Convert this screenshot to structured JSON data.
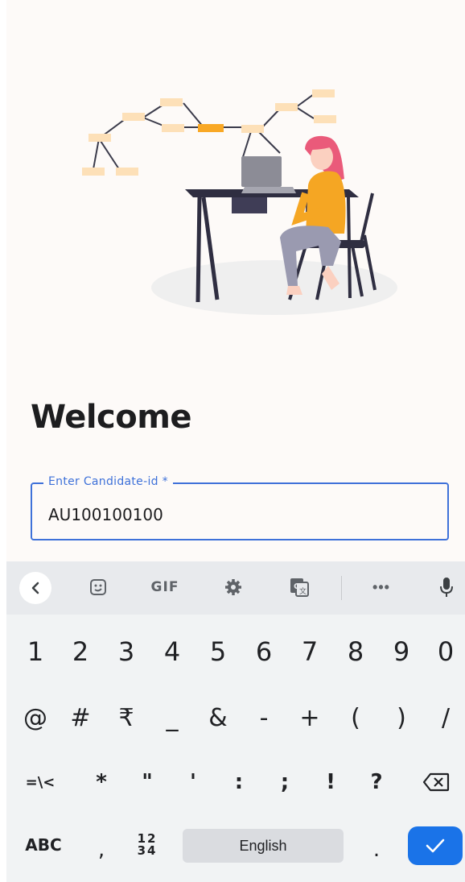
{
  "main": {
    "heading": "Welcome",
    "field": {
      "label": "Enter Candidate-id *",
      "value": "AU100100100"
    }
  },
  "keyboard": {
    "toolbar": {
      "back_icon": "chevron-left-icon",
      "items": [
        "sticker-icon",
        "GIF",
        "gear-icon",
        "translate-icon",
        "more-icon",
        "mic-icon"
      ],
      "gif_label": "GIF",
      "more_label": "•••"
    },
    "row_numbers": [
      "1",
      "2",
      "3",
      "4",
      "5",
      "6",
      "7",
      "8",
      "9",
      "0"
    ],
    "row_symbols": [
      "@",
      "#",
      "₹",
      "_",
      "&",
      "-",
      "+",
      "(",
      ")",
      "/"
    ],
    "row_symbols2": [
      "=\\<",
      "*",
      "\"",
      "'",
      ":",
      ";",
      "!",
      "?"
    ],
    "row_bottom": {
      "abc": "ABC",
      "comma": ",",
      "numpad_top": "12",
      "numpad_bottom": "34",
      "space": "English",
      "period": ".",
      "enter_icon": "check-icon"
    }
  },
  "colors": {
    "accent": "#3e71d9",
    "enter_key": "#1a73e8",
    "illustration_orange": "#f9a825",
    "illustration_peach": "#fde0b8"
  }
}
